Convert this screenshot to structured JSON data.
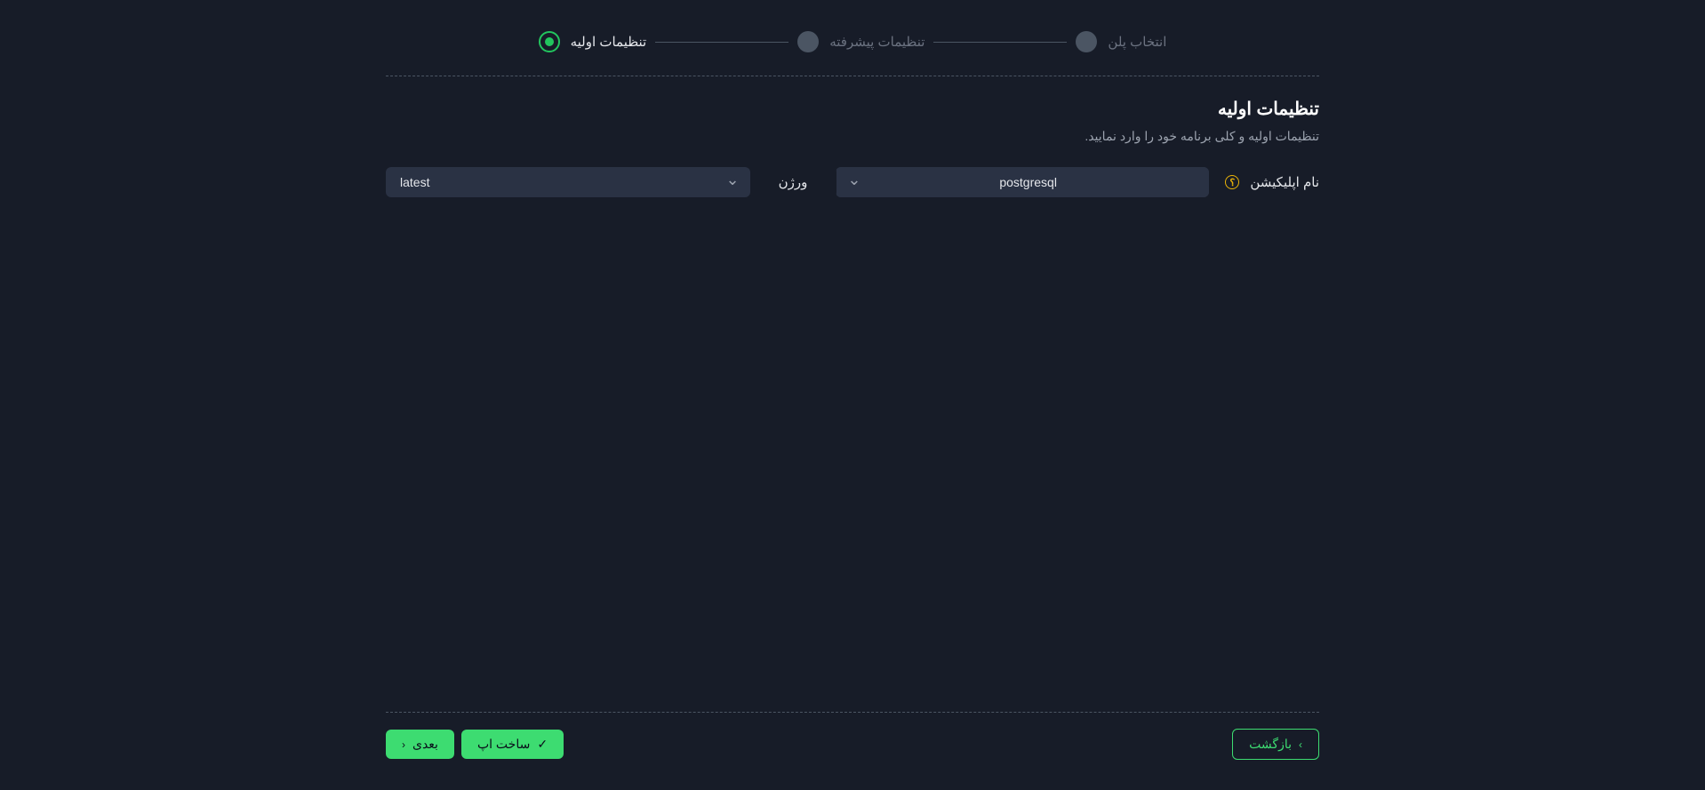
{
  "stepper": {
    "steps": [
      {
        "label": "تنظیمات اولیه",
        "active": true
      },
      {
        "label": "تنظیمات پیشرفته",
        "active": false
      },
      {
        "label": "انتخاب پلن",
        "active": false
      }
    ]
  },
  "section": {
    "title": "تنظیمات اولیه",
    "subtitle": "تنظیمات اولیه و کلی برنامه خود را وارد نمایید."
  },
  "form": {
    "app_name_label": "نام اپلیکیشن",
    "help_symbol": "؟",
    "app_name_value": "postgresql",
    "app_name_prefix_options": "",
    "version_label": "ورژن",
    "version_value": "latest"
  },
  "footer": {
    "back_label": "بازگشت",
    "next_label": "بعدی",
    "create_label": "ساخت اپ",
    "chevron_left": "‹",
    "chevron_right": "›",
    "check": "✓"
  }
}
